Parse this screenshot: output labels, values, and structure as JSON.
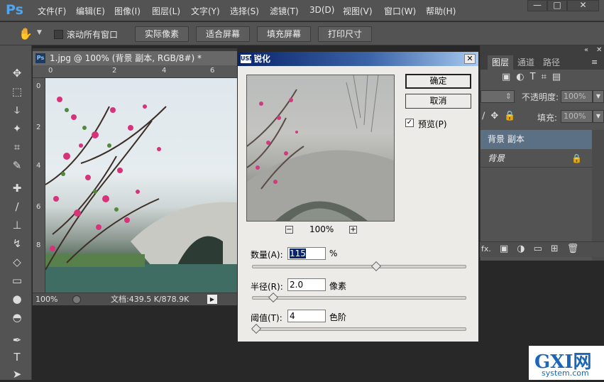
{
  "app": {
    "logo": "Ps"
  },
  "menu": [
    "文件(F)",
    "编辑(E)",
    "图像(I)",
    "图层(L)",
    "文字(Y)",
    "选择(S)",
    "滤镜(T)",
    "3D(D)",
    "视图(V)",
    "窗口(W)",
    "帮助(H)"
  ],
  "window_controls": {
    "minimize": "—",
    "maximize": "□",
    "close": "✕"
  },
  "options": {
    "scroll_all_label": "滚动所有窗口",
    "buttons": [
      "实际像素",
      "适合屏幕",
      "填充屏幕",
      "打印尺寸"
    ]
  },
  "document": {
    "tab_icon": "Ps",
    "tab_title": "1.jpg @ 100% (背景 副本, RGB/8#) *",
    "ruler_top": [
      "0",
      "2",
      "4",
      "6"
    ],
    "ruler_left": [
      "0",
      "2",
      "4",
      "6",
      "8"
    ],
    "zoom": "100%",
    "doc_info": "文档:439.5 K/878.9K"
  },
  "panel": {
    "tabs": [
      "图层",
      "通道",
      "路径"
    ],
    "opacity_label": "不透明度:",
    "opacity_value": "100%",
    "fill_label": "填充:",
    "fill_value": "100%",
    "layers": [
      {
        "name": "背景 副本"
      },
      {
        "name": "背景"
      }
    ],
    "fx_label": "fx."
  },
  "dialog": {
    "title_icon": "USM",
    "title": "锐化",
    "close": "✕",
    "ok_label": "确定",
    "cancel_label": "取消",
    "preview_label": "预览(P)",
    "preview_checked": true,
    "zoom_level": "100%",
    "zoom_out": "−",
    "zoom_in": "+",
    "amount": {
      "label": "数量(A):",
      "value": "115",
      "unit": "%",
      "slider": 0.58
    },
    "radius": {
      "label": "半径(R):",
      "value": "2.0",
      "unit": "像素",
      "slider": 0.1
    },
    "threshold": {
      "label": "阈值(T):",
      "value": "4",
      "unit": "色阶",
      "slider": 0.02
    }
  },
  "watermark": {
    "brand": "GXI网",
    "domain": "system.com"
  },
  "colors": {
    "accent": "#4fa6f0",
    "selected_layer": "#5c7085",
    "dialog_title": "#0a246a"
  }
}
